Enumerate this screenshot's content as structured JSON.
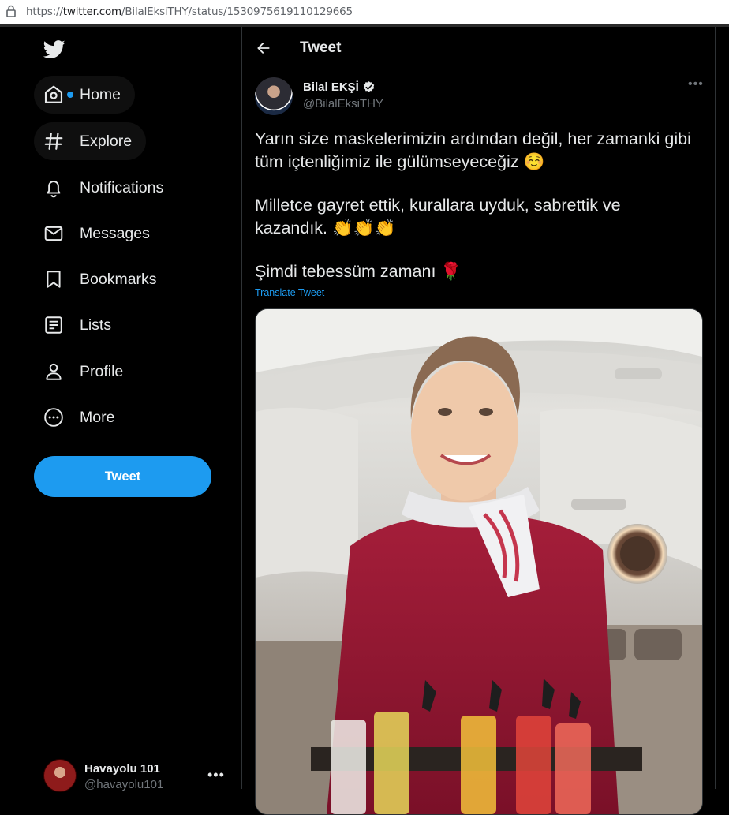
{
  "browser": {
    "url_prefix": "https://",
    "url_host": "twitter.com",
    "url_path": "/BilalEksiTHY/status/1530975619110129665"
  },
  "sidebar": {
    "logo_icon": "twitter-bird-icon",
    "items": [
      {
        "label": "Home",
        "icon": "home-icon"
      },
      {
        "label": "Explore",
        "icon": "hashtag-icon"
      },
      {
        "label": "Notifications",
        "icon": "bell-icon"
      },
      {
        "label": "Messages",
        "icon": "envelope-icon"
      },
      {
        "label": "Bookmarks",
        "icon": "bookmark-icon"
      },
      {
        "label": "Lists",
        "icon": "list-icon"
      },
      {
        "label": "Profile",
        "icon": "person-icon"
      },
      {
        "label": "More",
        "icon": "more-circle-icon"
      }
    ],
    "tweet_button": "Tweet",
    "account": {
      "name": "Havayolu 101",
      "handle": "@havayolu101",
      "more": "•••"
    }
  },
  "main": {
    "title": "Tweet",
    "author": {
      "name": "Bilal EKŞİ",
      "handle": "@BilalEksiTHY"
    },
    "more": "•••",
    "paragraphs": [
      "Yarın size maskelerimizin ardından değil, her zamanki gibi tüm içtenliğimiz ile gülümseyeceğiz ☺️",
      "Milletce gayret ettik, kurallara uyduk, sabrettik ve kazandık. 👏👏👏",
      "Şimdi tebessüm zamanı 🌹"
    ],
    "translate": "Translate Tweet"
  },
  "colors": {
    "accent": "#1d9bf0",
    "background": "#000000",
    "text": "#e7e9ea",
    "muted": "#71767b",
    "border": "#2f3336"
  }
}
